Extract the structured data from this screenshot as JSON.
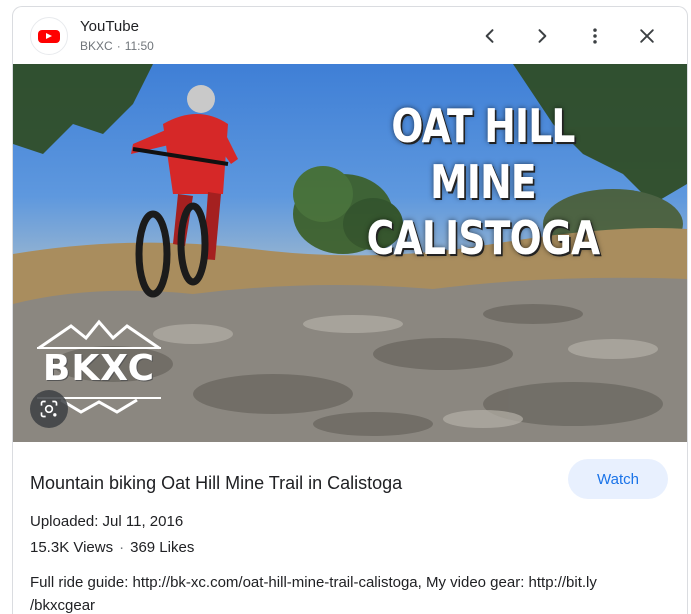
{
  "header": {
    "source_name": "YouTube",
    "channel": "BKXC",
    "time": "11:50",
    "icons": [
      "youtube-logo-icon",
      "chevron-left-icon",
      "chevron-right-icon",
      "more-vert-icon",
      "close-icon"
    ]
  },
  "hero": {
    "overlay_title_line1": "OAT HILL MINE",
    "overlay_title_line2": "CALISTOGA",
    "brand_logo_text": "BKXC",
    "lens_icon": "google-lens-icon"
  },
  "video": {
    "title": "Mountain biking Oat Hill Mine Trail in Calistoga",
    "watch_label": "Watch",
    "uploaded": "Uploaded: Jul 11, 2016",
    "views": "15.3K Views",
    "likes": "369 Likes",
    "description": "Full ride guide: http://bk-xc.com/oat-hill-mine-trail-calistoga, My video gear: http://bit.ly /bkxcgear"
  },
  "colors": {
    "accent": "#1a73e8",
    "watch_bg": "#e8f0fe",
    "youtube_red": "#ff0000",
    "sky": "#4a86d8"
  }
}
